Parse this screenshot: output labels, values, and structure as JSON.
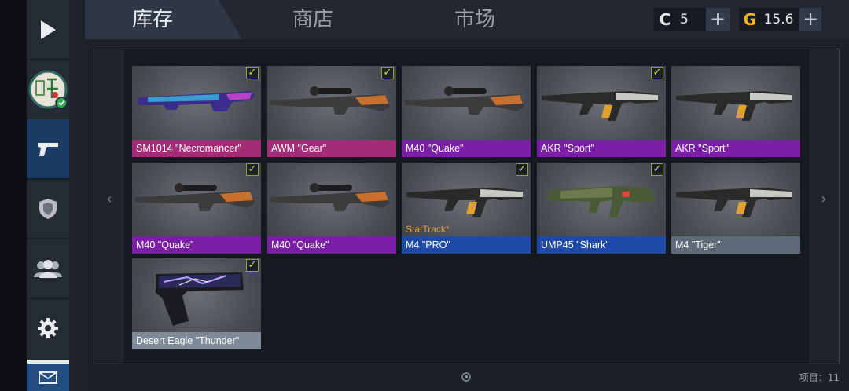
{
  "tabs": {
    "inventory": "库存",
    "shop": "商店",
    "market": "市场"
  },
  "currency": {
    "coins": {
      "icon": "C",
      "value": "5",
      "add": "+"
    },
    "gold": {
      "icon": "G",
      "value": "15.6",
      "add": "+"
    }
  },
  "nav": {
    "prev": "‹",
    "next": "›"
  },
  "items": [
    {
      "name": "SM1014 \"Necromancer\"",
      "rarity_color": "#a32c76",
      "checked": true,
      "stattrack": "",
      "icon": "shotgun-icon"
    },
    {
      "name": "AWM \"Gear\"",
      "rarity_color": "#a32c76",
      "checked": true,
      "stattrack": "",
      "icon": "sniper-rifle-icon"
    },
    {
      "name": "M40 \"Quake\"",
      "rarity_color": "#7a1fa6",
      "checked": false,
      "stattrack": "",
      "icon": "sniper-rifle-icon"
    },
    {
      "name": "AKR \"Sport\"",
      "rarity_color": "#7a1fa6",
      "checked": true,
      "stattrack": "",
      "icon": "assault-rifle-icon"
    },
    {
      "name": "AKR \"Sport\"",
      "rarity_color": "#7a1fa6",
      "checked": false,
      "stattrack": "",
      "icon": "assault-rifle-icon"
    },
    {
      "name": "M40 \"Quake\"",
      "rarity_color": "#7a1fa6",
      "checked": true,
      "stattrack": "",
      "icon": "sniper-rifle-icon"
    },
    {
      "name": "M40 \"Quake\"",
      "rarity_color": "#7a1fa6",
      "checked": false,
      "stattrack": "",
      "icon": "sniper-rifle-icon"
    },
    {
      "name": "M4 \"PRO\"",
      "rarity_color": "#1f4aa8",
      "checked": true,
      "stattrack": "StatTrack*",
      "icon": "assault-rifle-icon"
    },
    {
      "name": "UMP45 \"Shark\"",
      "rarity_color": "#1f4aa8",
      "checked": true,
      "stattrack": "",
      "icon": "smg-icon"
    },
    {
      "name": "M4 \"Tiger\"",
      "rarity_color": "#5e6a78",
      "checked": false,
      "stattrack": "",
      "icon": "assault-rifle-icon"
    },
    {
      "name": "Desert Eagle \"Thunder\"",
      "rarity_color": "#7c8a96",
      "checked": true,
      "stattrack": "",
      "icon": "pistol-icon"
    }
  ],
  "items_count": "项目：11"
}
